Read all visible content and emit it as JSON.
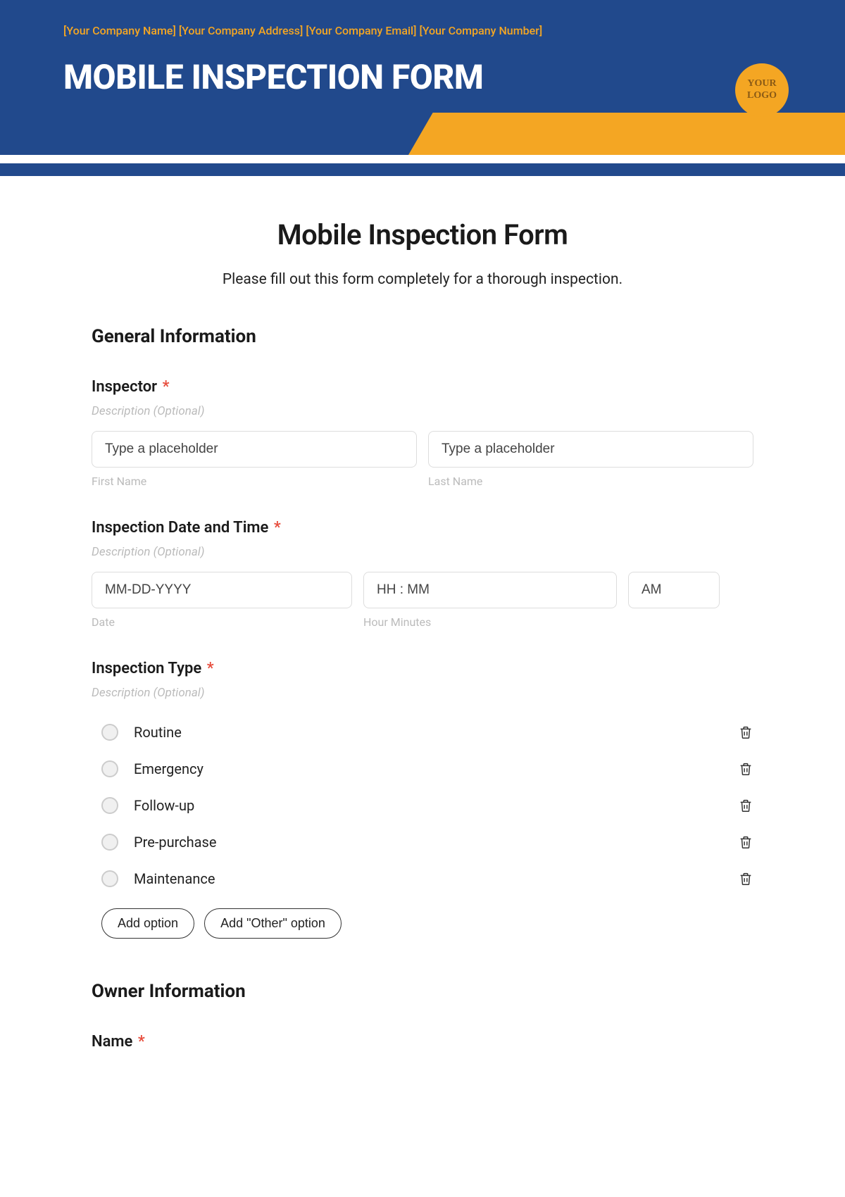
{
  "header": {
    "meta": "[Your Company Name] [Your Company Address] [Your Company Email] [Your Company Number]",
    "title": "MOBILE INSPECTION FORM",
    "logo_line1": "YOUR",
    "logo_line2": "LOGO"
  },
  "form": {
    "title": "Mobile Inspection Form",
    "subtitle": "Please fill out this form completely for a thorough inspection."
  },
  "general": {
    "heading": "General Information",
    "inspector": {
      "label": "Inspector",
      "desc": "Description (Optional)",
      "first_ph": "Type a placeholder",
      "last_ph": "Type a placeholder",
      "first_sub": "First Name",
      "last_sub": "Last Name"
    },
    "datetime": {
      "label": "Inspection Date and Time",
      "desc": "Description (Optional)",
      "date_ph": "MM-DD-YYYY",
      "time_ph": "HH : MM",
      "ampm": "AM",
      "date_sub": "Date",
      "time_sub": "Hour Minutes"
    },
    "type": {
      "label": "Inspection Type",
      "desc": "Description (Optional)",
      "options": [
        "Routine",
        "Emergency",
        "Follow-up",
        "Pre-purchase",
        "Maintenance"
      ],
      "add_option": "Add option",
      "add_other": "Add \"Other\" option"
    }
  },
  "owner": {
    "heading": "Owner Information",
    "name_label": "Name"
  },
  "req_mark": "*"
}
